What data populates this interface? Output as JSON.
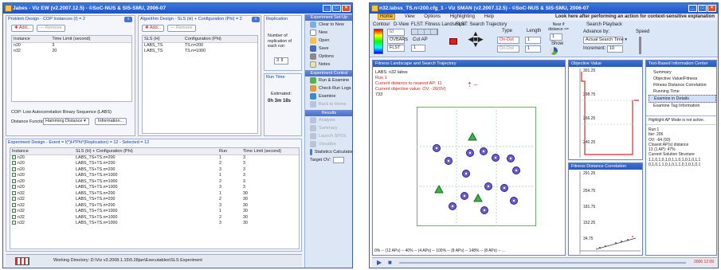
{
  "left_window": {
    "title": "Jabes - Viz EW (v2.2007.12.5) - ©SoC-NUS & SIS-SMU, 2006-07",
    "problem_panel": {
      "header": "Problem Design - COP Instances (I) = 2",
      "add_label": "Add...",
      "remove_label": "Remove",
      "columns": [
        "Instance",
        "Time Limit (second)"
      ],
      "rows": [
        [
          "n20",
          "3"
        ],
        [
          "n32",
          "20"
        ]
      ],
      "cop_label": "COP: Low Autocorrelation Binary Sequence (LABS)",
      "distance_label": "Distance Function:",
      "distance_value": "Hamming Distance",
      "information_label": "Information..."
    },
    "algorithm_panel": {
      "header": "Algorithm Design - SLS (H) + Configuration (Phi) = 2",
      "add_label": "Add...",
      "remove_label": "Remove",
      "columns": [
        "SLS (H)",
        "Configuration (Phi)"
      ],
      "rows": [
        [
          "LABS_TS",
          "TS.n=200"
        ],
        [
          "LABS_TS",
          "TS.n=1000"
        ]
      ]
    },
    "replication_panel": {
      "header": "Replication",
      "label": "Number of replication of each run:",
      "value": "3"
    },
    "runtime_panel": {
      "header": "Run Time",
      "label": "Estimated:",
      "value": "0h 3m 18s"
    },
    "experiment_panel": {
      "header": "Experiment Design - Event = I(*)H*Phi*(Replication) = 12 - Selected = 12",
      "columns": [
        "Instance",
        "SLS (H) + Configuration (Phi)",
        "Run",
        "Time Limit (second)"
      ],
      "rows": [
        [
          "n20",
          "LABS_TS+TS.n=200",
          "1",
          "3"
        ],
        [
          "n20",
          "LABS_TS+TS.n=200",
          "2",
          "3"
        ],
        [
          "n20",
          "LABS_TS+TS.n=200",
          "3",
          "3"
        ],
        [
          "n20",
          "LABS_TS+TS.n=1000",
          "1",
          "3"
        ],
        [
          "n20",
          "LABS_TS+TS.n=1000",
          "2",
          "3"
        ],
        [
          "n20",
          "LABS_TS+TS.n=1000",
          "3",
          "3"
        ],
        [
          "n32",
          "LABS_TS+TS.n=200",
          "1",
          "30"
        ],
        [
          "n32",
          "LABS_TS+TS.n=200",
          "2",
          "30"
        ],
        [
          "n32",
          "LABS_TS+TS.n=200",
          "3",
          "30"
        ],
        [
          "n32",
          "LABS_TS+TS.n=1000",
          "1",
          "30"
        ],
        [
          "n32",
          "LABS_TS+TS.n=1000",
          "2",
          "30"
        ],
        [
          "n32",
          "LABS_TS+TS.n=1000",
          "3",
          "30"
        ]
      ]
    },
    "status": {
      "working_directory": "Working Directory: D:\\Viz v3.2008.1.15\\5.28jan\\Executables\\SLS Experiment"
    },
    "sidebar": {
      "setup_title": "Experiment Set-Up",
      "setup_items": [
        "Clear to New",
        "New",
        "Open",
        "Save",
        "Options",
        "Notes"
      ],
      "control_title": "Experiment Control",
      "control_items": [
        "Run & Examine",
        "Check Run Logs",
        "Examine",
        "Back to Home"
      ],
      "results_title": "Results",
      "results_items": [
        "Analysis",
        "Summary",
        "Launch SPSS",
        "Visualize",
        "Statistics Calculator"
      ],
      "target_label": "Target OV:"
    }
  },
  "right_window": {
    "title": "n32.labss_TS.n=200.cfg_1 - Viz SMAN (v2.2007.12.5) - ©SoC-NUS & SIS-SMU, 2006-07",
    "menu": [
      "Home",
      "View",
      "Options",
      "Highlighting",
      "Help"
    ],
    "banner": "Look here after performing an action for context-sensitive explanation",
    "ribbon": {
      "contour_label": "Contour",
      "dview_label": "D-View",
      "flst_fitness_label": "FLST: Fitness Landscape",
      "flst_search_label": "FLST: Search Trajectory",
      "type_label": "Type",
      "length_label": "Length",
      "type_value1": "On-Dot",
      "type_value2": "On-Dot",
      "search_playback_label": "Search Playback",
      "advance_label": "Advance by:",
      "advance_value": "Actual Search Time",
      "increment_label": "Increment:",
      "increment_value": "10",
      "speed_label": "Speed",
      "radius_label": "Near if distance <=",
      "radius_value": "1",
      "cut_label": "Cut AP",
      "show_label": "Show",
      "ovbars_label": "OVBARS",
      "flst_label": "FLST"
    },
    "fitness_panel": {
      "header": "Fitness Landscape and Search Trajectory",
      "lines": [
        "LABS: n32 labss",
        "Run 1",
        "Current distance to nearest AP: 11",
        "Current objective value: OV: -26(0V)",
        "733"
      ],
      "footer": "0% -- (12 APs) -- 40% -- (4 APs) -- 100% -- (8 APs) -- 148% -- (8 APs) -- ..."
    },
    "objective_panel": {
      "header": "Objective Value",
      "y_ticks": [
        "301.25",
        "298.75",
        "266.25",
        "240.25"
      ]
    },
    "fdc_panel": {
      "header": "Fitness Distance Correlation",
      "y_ticks": [
        "291.25",
        "254.75",
        "181.75",
        "152.25",
        "34.75"
      ]
    },
    "text_info_panel": {
      "header": "Text-Based Information Center",
      "tree_items": [
        "Summary",
        "Objective Value/Fitness",
        "Fitness Distance Correlation",
        "Running Time",
        "Examine in Details",
        "Examine Tag Information"
      ],
      "selected_index": 4,
      "highlight_text": "Highlight AP Mode is not active.",
      "details": [
        "Run 1",
        "Iter: 206",
        "OV: -64 (93)",
        "Closest AP(s) distance",
        "13 (1 AP): 47%",
        "Current Solution Structure",
        "1,1,0,1,0,1,0,1,1,0,1,0,1,0,1,1",
        "0,1,0,1,1,0,1,0,1,1,0,1,0,1,0,1"
      ]
    },
    "status_right": "2006 12 09"
  },
  "colors": {
    "accent": "#2a58bb",
    "title_bar": "#1f53c6",
    "green_marker": "#3ab34a",
    "purple_marker": "#6e5fd0",
    "red_series": "#d42a2a"
  }
}
